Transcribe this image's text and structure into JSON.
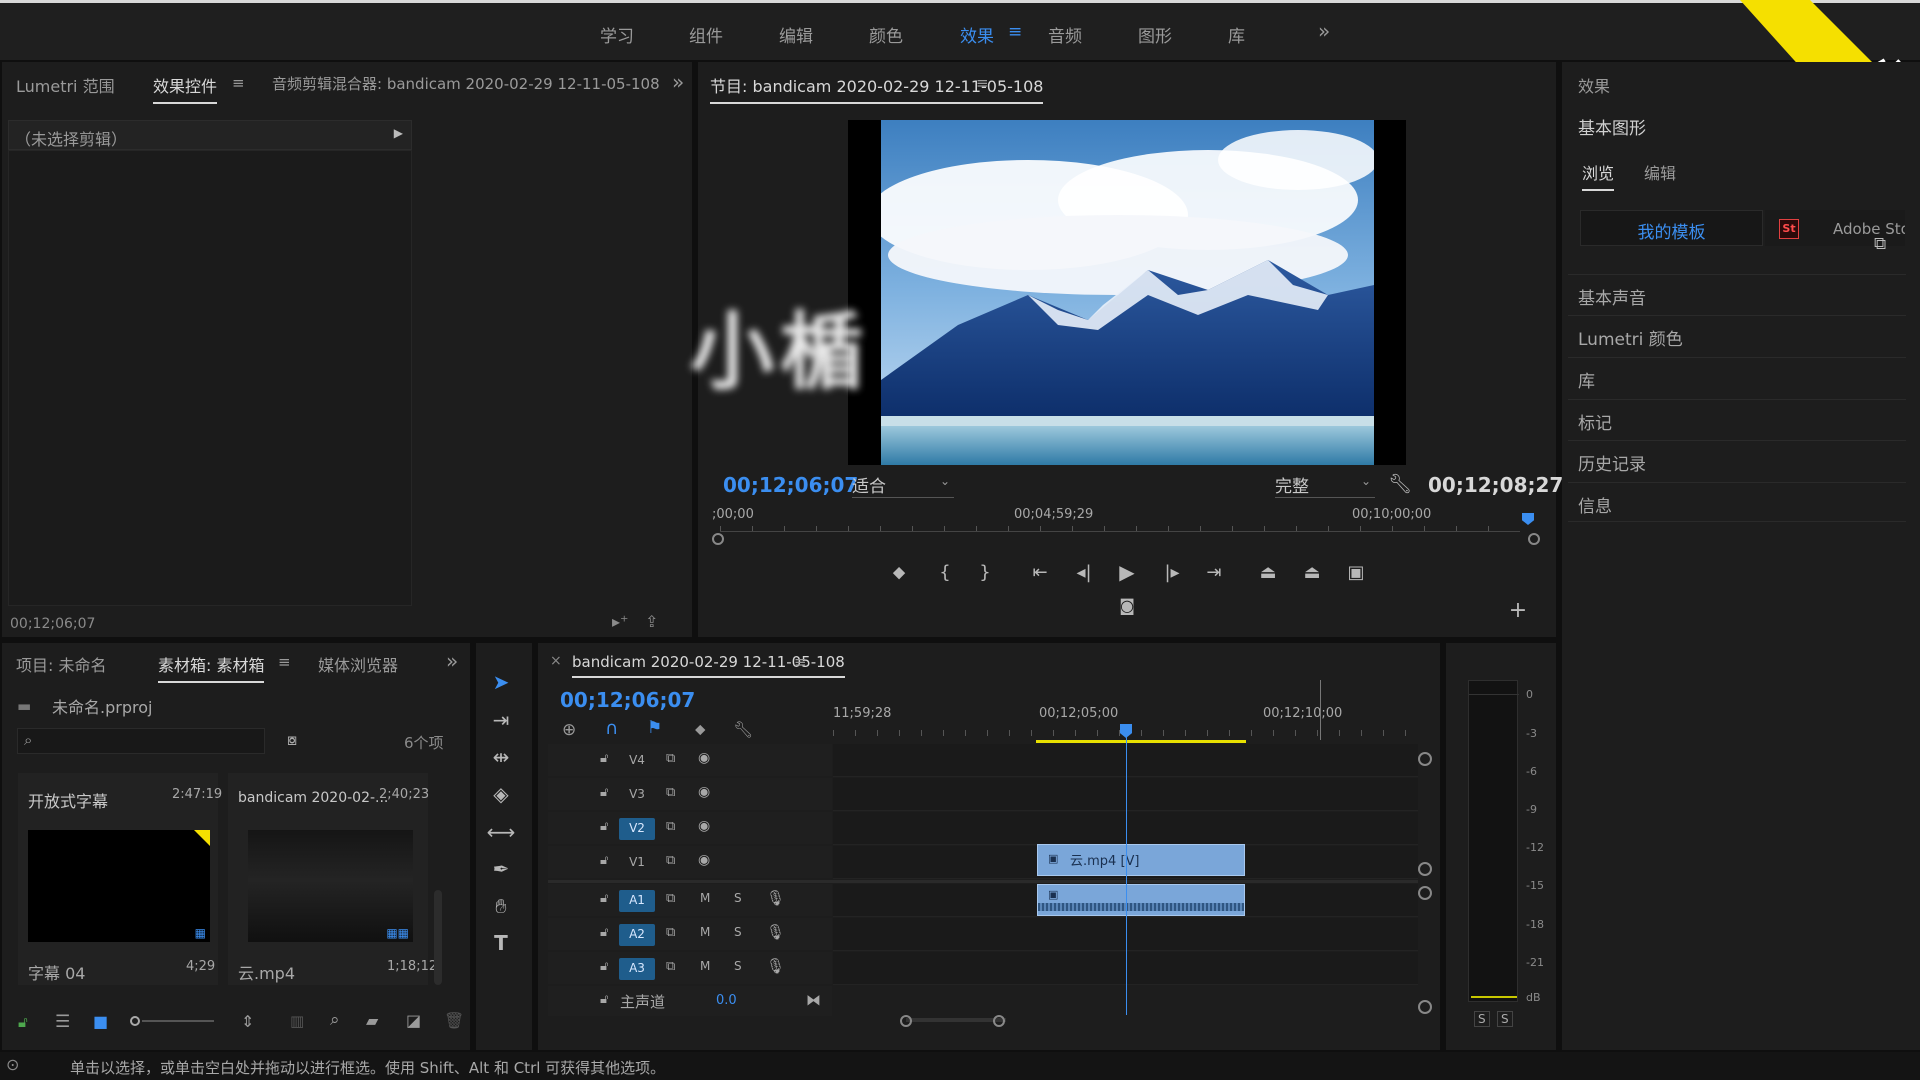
{
  "workspaces": {
    "items": [
      "学习",
      "组件",
      "编辑",
      "颜色",
      "效果",
      "音频",
      "图形",
      "库"
    ],
    "active_index": 4,
    "overflow": "»"
  },
  "corner_badge": "小楯",
  "watermark": "小楯",
  "source_panel": {
    "tabs": [
      "Lumetri 范围",
      "效果控件",
      "音频剪辑混合器: bandicam 2020-02-29 12-11-05-108"
    ],
    "active_tab": 1,
    "no_clip": "（未选择剪辑）",
    "timecode": "00;12;06;07"
  },
  "program": {
    "title": "节目: bandicam 2020-02-29 12-11-05-108",
    "timecode_current": "00;12;06;07",
    "timecode_duration": "00;12;08;27",
    "zoom": "适合",
    "quality": "完整",
    "ruler": [
      ";00;00",
      "00;04;59;29",
      "00;10;00;00"
    ]
  },
  "effects_panel": {
    "title": "效果",
    "essential_graphics": "基本图形",
    "tabs": [
      "浏览",
      "编辑"
    ],
    "my_templates": "我的模板",
    "adobe_stock": "Adobe Stock",
    "sections": [
      "基本声音",
      "Lumetri 颜色",
      "库",
      "标记",
      "历史记录",
      "信息"
    ]
  },
  "project_panel": {
    "tabs": [
      "项目: 未命名",
      "素材箱: 素材箱",
      "媒体浏览器"
    ],
    "active_tab": 1,
    "project_file": "未命名.prproj",
    "search_placeholder": "",
    "item_count": "6个项",
    "items": [
      {
        "name": "开放式字幕",
        "duration": "2:47:19",
        "caption": "字幕 04",
        "caption_duration": "4;29"
      },
      {
        "name": "bandicam 2020-02-...",
        "duration": "2;40;23",
        "caption": "云.mp4",
        "caption_duration": "1;18;12"
      }
    ]
  },
  "timeline": {
    "sequence_name": "bandicam 2020-02-29 12-11-05-108",
    "timecode": "00;12;06;07",
    "ruler": [
      "11;59;28",
      "00;12;05;00",
      "00;12;10;00"
    ],
    "video_tracks": [
      "V4",
      "V3",
      "V2",
      "V1"
    ],
    "audio_tracks": [
      "A1",
      "A2",
      "A3"
    ],
    "master_label": "主声道",
    "master_value": "0.0",
    "clip_video": "云.mp4 [V]",
    "mute": "M",
    "solo": "S"
  },
  "meter": {
    "labels": [
      "0",
      "-3",
      "-6",
      "-9",
      "-12",
      "-15",
      "-18",
      "-21",
      "dB"
    ],
    "solo_buttons": [
      "S",
      "S"
    ]
  },
  "status_bar": {
    "text": "单击以选择，或单击空白处并拖动以进行框选。使用 Shift、Alt 和 Ctrl 可获得其他选项。"
  },
  "colors": {
    "accent": "#3b8ef0",
    "badge": "#f5e000",
    "track_on": "#1f5d8c",
    "clip": "#7aa6d9",
    "work_area": "#e8e000"
  }
}
